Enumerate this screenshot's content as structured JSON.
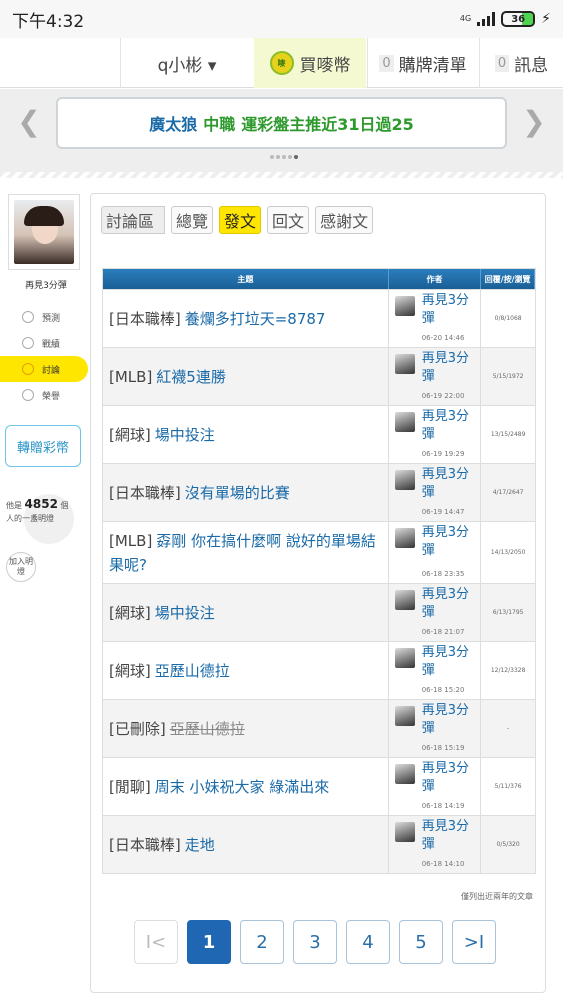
{
  "status": {
    "time": "下午4:32",
    "network": "4G",
    "battery": "36"
  },
  "nav": {
    "user": "q小彬 ▾",
    "buy": "買嘜幣",
    "coin_text": "嘜",
    "shop_count": "0",
    "shop": "購牌清單",
    "msg_count": "0",
    "msg": "訊息"
  },
  "banner": {
    "part1": "廣太狼",
    "part2": "中職",
    "part3": "運彩盤主推近31日過25"
  },
  "sidebar": {
    "username": "再見3分彈",
    "menu": [
      "預測",
      "戰績",
      "討論",
      "榮譽"
    ],
    "gift": "轉贈彩幣",
    "bulb_prefix": "他是",
    "bulb_count": "4852",
    "bulb_suffix": "個",
    "bulb_line2": "人的一盞明燈",
    "join": "加入明燈"
  },
  "tabs": [
    "討論區",
    "總覽",
    "發文",
    "回文",
    "感謝文"
  ],
  "table": {
    "headers": [
      "主題",
      "作者",
      "回覆/按/瀏覽"
    ],
    "rows": [
      {
        "tag": "[日本職棒]",
        "title": "養爛多打垃天=8787",
        "author": "再見3分彈",
        "date": "06-20 14:46",
        "stats": "0/8/1068"
      },
      {
        "tag": "[MLB]",
        "title": "紅襪5連勝",
        "author": "再見3分彈",
        "date": "06-19 22:00",
        "stats": "5/15/1972"
      },
      {
        "tag": "[網球]",
        "title": "場中投注",
        "author": "再見3分彈",
        "date": "06-19 19:29",
        "stats": "13/15/2489"
      },
      {
        "tag": "[日本職棒]",
        "title": "沒有單場的比賽",
        "author": "再見3分彈",
        "date": "06-19 14:47",
        "stats": "4/17/2647"
      },
      {
        "tag": "[MLB]",
        "title": "孬剛 你在搞什麼啊 說好的單場結果呢?",
        "author": "再見3分彈",
        "date": "06-18 23:35",
        "stats": "14/13/2050"
      },
      {
        "tag": "[網球]",
        "title": "場中投注",
        "author": "再見3分彈",
        "date": "06-18 21:07",
        "stats": "6/13/1795"
      },
      {
        "tag": "[網球]",
        "title": "亞歷山德拉",
        "author": "再見3分彈",
        "date": "06-18 15:20",
        "stats": "12/12/3328"
      },
      {
        "tag": "[已刪除]",
        "title": "亞歷山德拉",
        "author": "再見3分彈",
        "date": "06-18 15:19",
        "stats": "-"
      },
      {
        "tag": "[閒聊]",
        "title": "周末 小妹祝大家 綠滿出來",
        "author": "再見3分彈",
        "date": "06-18 14:19",
        "stats": "5/11/376"
      },
      {
        "tag": "[日本職棒]",
        "title": "走地",
        "author": "再見3分彈",
        "date": "06-18 14:10",
        "stats": "0/5/320"
      }
    ]
  },
  "note": "僅列出近兩年的文章",
  "pager": {
    "first": "I<",
    "pages": [
      "1",
      "2",
      "3",
      "4",
      "5"
    ],
    "last": ">I",
    "current": "1"
  },
  "colors": {
    "accent": "#1f66b3",
    "highlight": "#ffe600",
    "link": "#1a6aa8",
    "green": "#2e9a2e"
  }
}
